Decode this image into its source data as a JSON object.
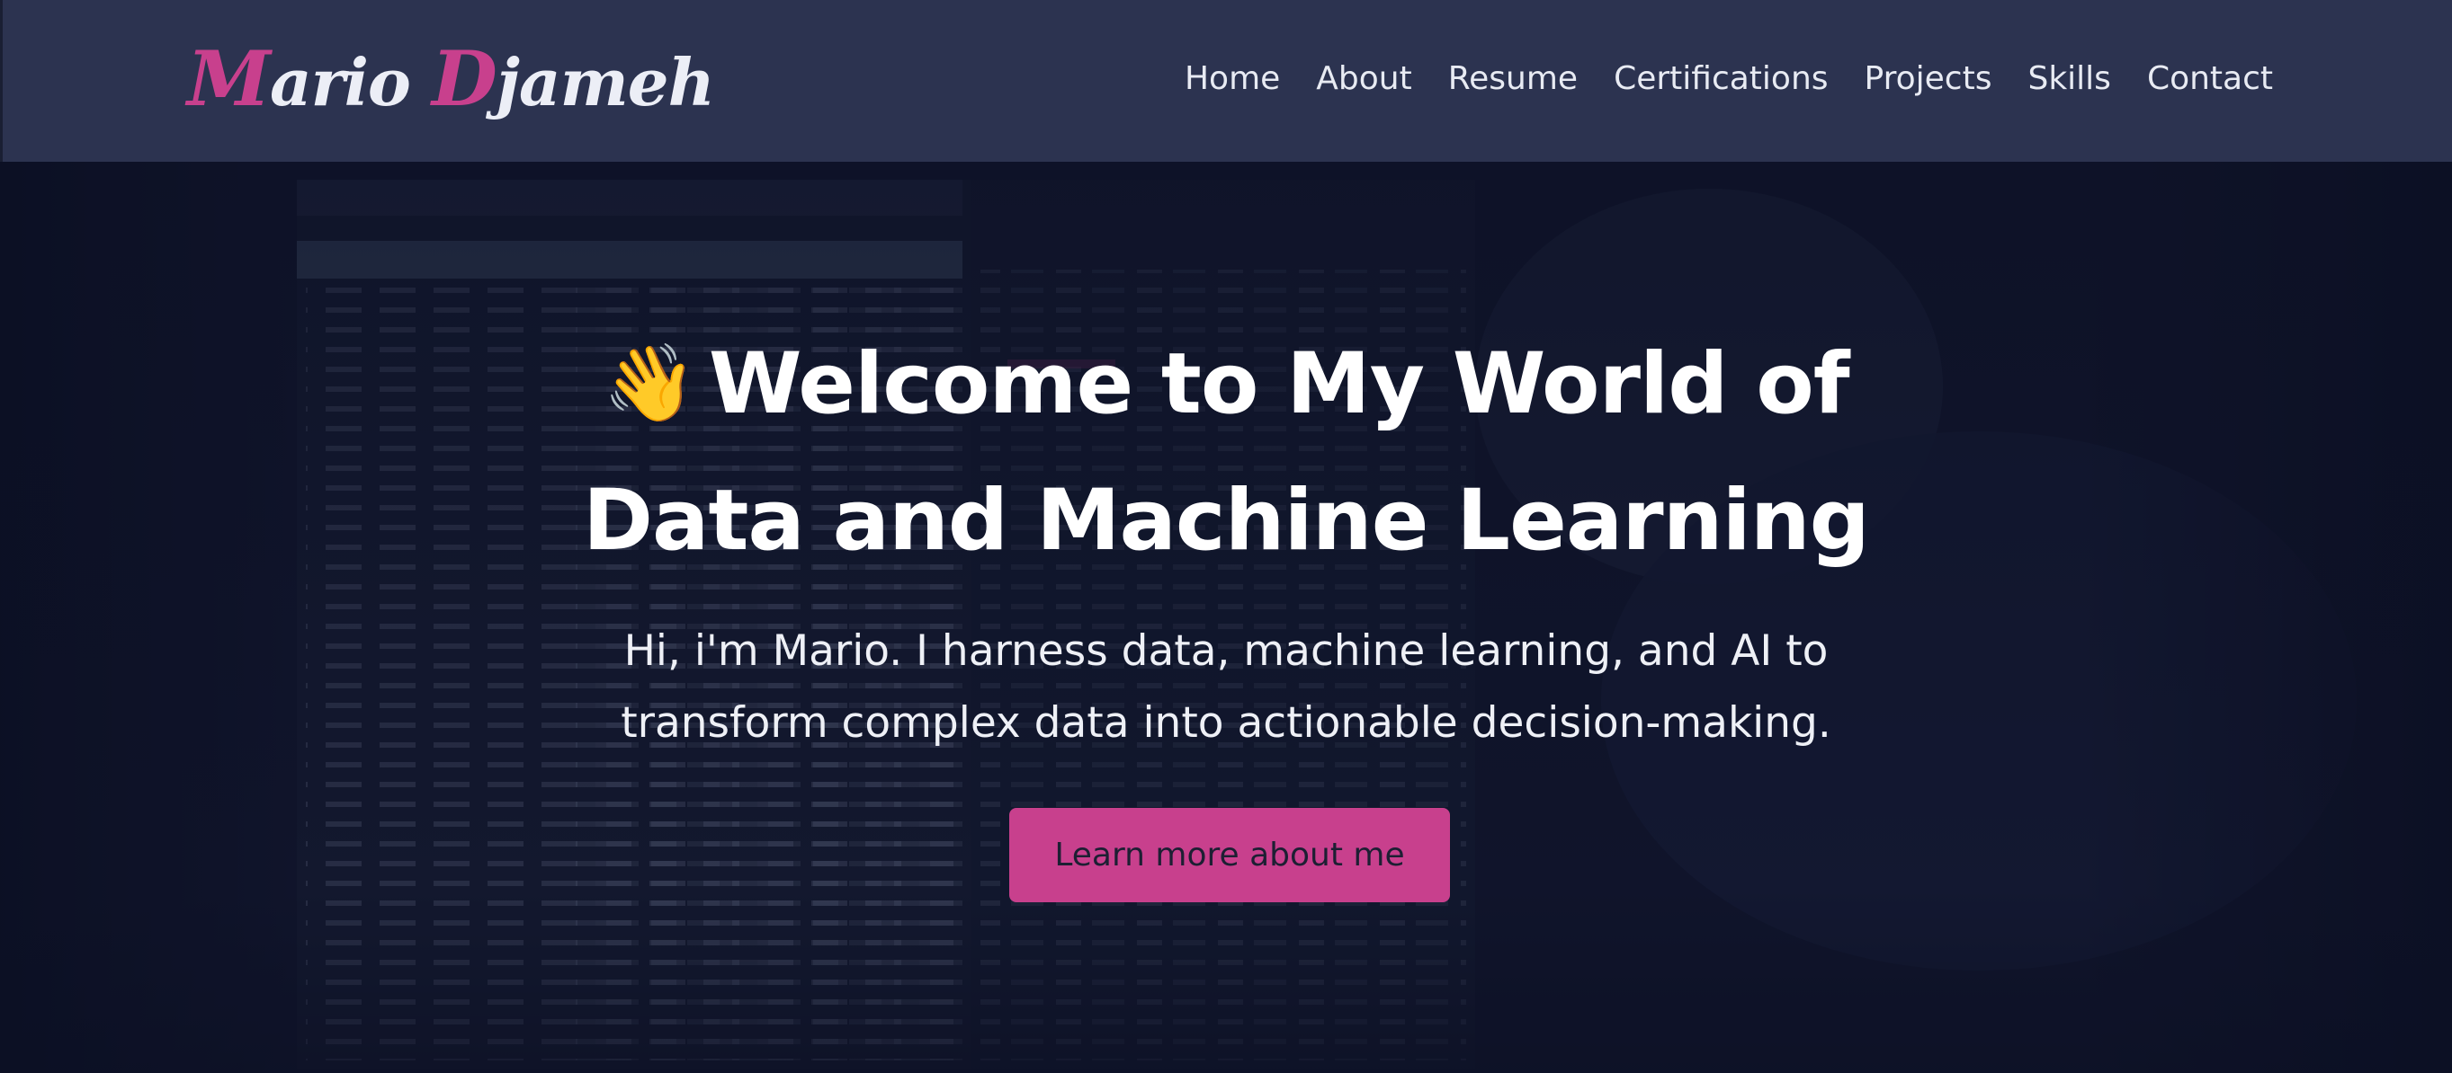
{
  "brand": {
    "first_initial": "M",
    "first_rest": "ario",
    "last_initial": "D",
    "last_rest": "jameh",
    "accent_color": "#c8408d"
  },
  "nav": {
    "items": [
      {
        "label": "Home"
      },
      {
        "label": "About"
      },
      {
        "label": "Resume"
      },
      {
        "label": "Certifications"
      },
      {
        "label": "Projects"
      },
      {
        "label": "Skills"
      },
      {
        "label": "Contact"
      }
    ]
  },
  "hero": {
    "emoji": "👋",
    "title_line1": "Welcome to My World of",
    "title_line2": "Data and Machine Learning",
    "subtitle_line1": "Hi, i'm Mario. I harness data, machine learning, and AI to",
    "subtitle_line2": "transform complex data into actionable decision-making.",
    "cta_label": "Learn more about me",
    "cta_color": "#c8408d"
  },
  "colors": {
    "navbar_bg": "#2c3350",
    "hero_bg": "#10152a",
    "text": "#ffffff"
  }
}
